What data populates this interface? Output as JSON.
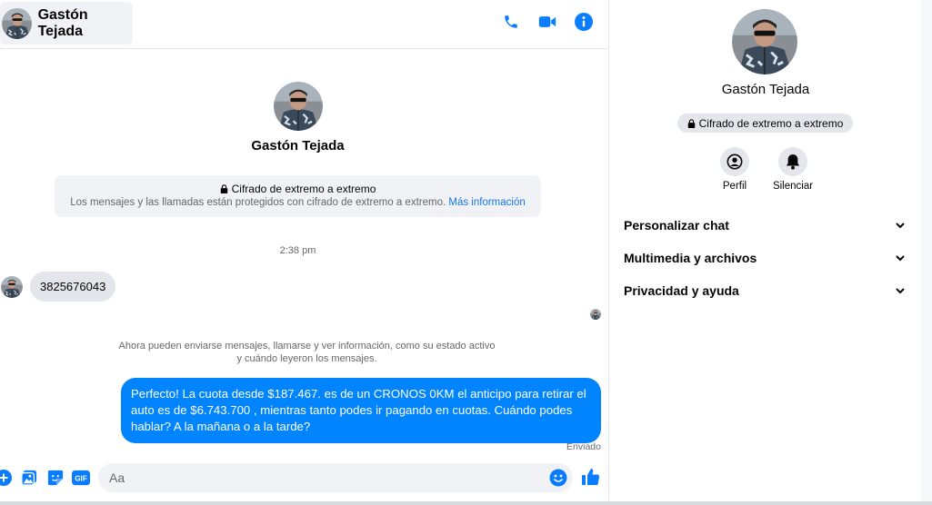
{
  "contact": {
    "name": "Gastón Tejada"
  },
  "header": {
    "call_icon": "phone-icon",
    "video_icon": "video-camera-icon",
    "info_icon": "info-icon"
  },
  "encryption": {
    "title": "Cifrado de extremo a extremo",
    "description": "Los mensajes y las llamadas están protegidos con cifrado de extremo a extremo.",
    "link": "Más información"
  },
  "conversation": {
    "timestamp": "2:38 pm",
    "incoming": [
      {
        "text": "3825676043"
      }
    ],
    "system_note_line1": "Ahora pueden enviarse mensajes, llamarse y ver información, como su estado activo",
    "system_note_line2": "y cuándo leyeron los mensajes.",
    "outgoing": [
      {
        "text": "Perfecto! La cuota desde $187.467. es de un CRONOS 0KM el anticipo para retirar el auto es de $6.743.700 , mientras tanto podes ir pagando en cuotas. Cuándo podes hablar? A la mañana o a la tarde?"
      }
    ],
    "status": "Enviado"
  },
  "composer": {
    "placeholder": "Aa",
    "icons": [
      "plus-icon",
      "image-icon",
      "sticker-icon",
      "gif-icon",
      "emoji-icon",
      "thumbs-up-icon"
    ],
    "gif_label": "GIF"
  },
  "details": {
    "name": "Gastón Tejada",
    "encryption_badge": "Cifrado de extremo a extremo",
    "actions": [
      {
        "label": "Perfil",
        "icon": "profile-icon"
      },
      {
        "label": "Silenciar",
        "icon": "bell-icon"
      }
    ],
    "sections": [
      {
        "label": "Personalizar chat"
      },
      {
        "label": "Multimedia y archivos"
      },
      {
        "label": "Privacidad y ayuda"
      }
    ]
  },
  "colors": {
    "accent": "#0084ff",
    "icon_blue": "#0a7cff",
    "bubble_in": "#e4e6eb",
    "panel_bg": "#f0f2f5"
  }
}
